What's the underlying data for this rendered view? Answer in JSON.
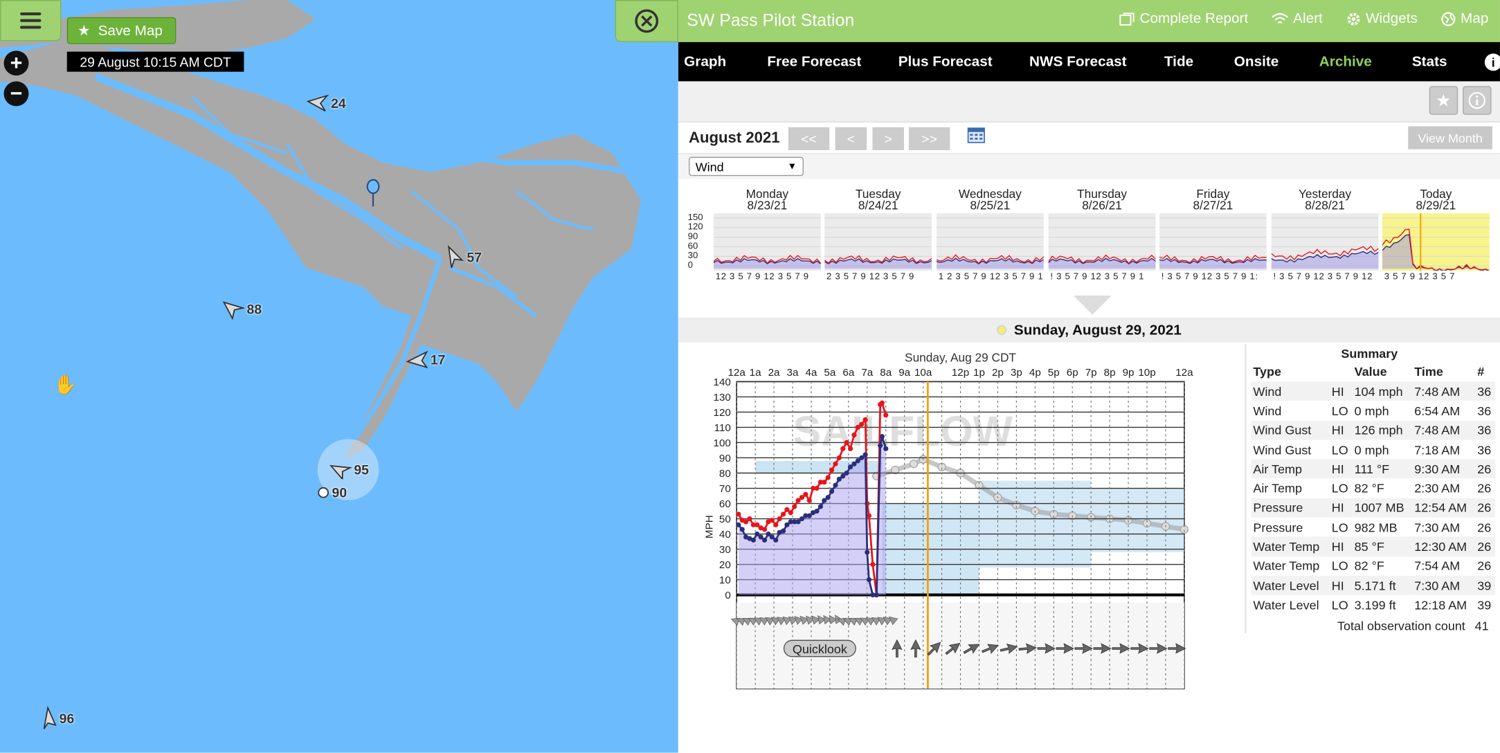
{
  "map": {
    "save_label": "Save Map",
    "timestamp": "29 August 10:15 AM CDT",
    "zoom_in": "+",
    "zoom_out": "−",
    "markers": [
      {
        "value": "24",
        "dir": 260
      },
      {
        "value": "57",
        "dir": 330
      },
      {
        "value": "88",
        "dir": 290
      },
      {
        "value": "17",
        "dir": 250
      },
      {
        "value": "95",
        "dir": 280
      },
      {
        "value": "90",
        "dir": 0
      },
      {
        "value": "96",
        "dir": 350
      }
    ]
  },
  "panel": {
    "station_title": "SW Pass Pilot Station",
    "top_actions": [
      {
        "label": "Complete Report",
        "icon": "report-icon"
      },
      {
        "label": "Alert",
        "icon": "wifi-icon"
      },
      {
        "label": "Widgets",
        "icon": "gear-icon"
      },
      {
        "label": "Map",
        "icon": "globe-icon"
      }
    ],
    "nav": [
      {
        "label": "Graph"
      },
      {
        "label": "Free Forecast"
      },
      {
        "label": "Plus Forecast"
      },
      {
        "label": "NWS Forecast"
      },
      {
        "label": "Tide"
      },
      {
        "label": "Onsite"
      },
      {
        "label": "Archive",
        "active": true
      },
      {
        "label": "Stats"
      }
    ],
    "month_label": "August 2021",
    "pager": [
      "<<",
      "<",
      ">",
      ">>"
    ],
    "view_month": "View Month",
    "select_value": "Wind",
    "week": [
      {
        "name": "Monday",
        "date": "8/23/21",
        "xlabels": "12 3 5 7 9 12 3 5 7 9"
      },
      {
        "name": "Tuesday",
        "date": "8/24/21",
        "xlabels": "2 3 5 7 9 12 3 5 7 9"
      },
      {
        "name": "Wednesday",
        "date": "8/25/21",
        "xlabels": "1 2 3 5 7 9 12 3 5 7 9 1"
      },
      {
        "name": "Thursday",
        "date": "8/26/21",
        "xlabels": "! 3 5 7 9 12 3 5 7 9 1"
      },
      {
        "name": "Friday",
        "date": "8/27/21",
        "xlabels": "! 3 5 7 9 12 3 5 7 9 1:"
      },
      {
        "name": "Yesterday",
        "date": "8/28/21",
        "xlabels": "! 3 5 7 9 12 3 5 7 9 12"
      },
      {
        "name": "Today",
        "date": "8/29/21",
        "xlabels": "3 5 7 9 12 3 5 7"
      }
    ],
    "mini_yticks": [
      "150",
      "120",
      "90",
      "60",
      "30",
      "0"
    ],
    "day_title": "Sunday, August 29, 2021",
    "summary": {
      "title": "Summary",
      "headers": [
        "Type",
        "",
        "Value",
        "Time",
        "#"
      ],
      "rows": [
        [
          "Wind",
          "HI",
          "104 mph",
          "7:48 AM",
          "36"
        ],
        [
          "Wind",
          "LO",
          "0 mph",
          "6:54 AM",
          "36"
        ],
        [
          "Wind Gust",
          "HI",
          "126 mph",
          "7:48 AM",
          "36"
        ],
        [
          "Wind Gust",
          "LO",
          "0 mph",
          "7:18 AM",
          "36"
        ],
        [
          "Air Temp",
          "HI",
          "111 °F",
          "9:30 AM",
          "26"
        ],
        [
          "Air Temp",
          "LO",
          "82 °F",
          "2:30 AM",
          "26"
        ],
        [
          "Pressure",
          "HI",
          "1007 MB",
          "12:54 AM",
          "26"
        ],
        [
          "Pressure",
          "LO",
          "982 MB",
          "7:30 AM",
          "26"
        ],
        [
          "Water Temp",
          "HI",
          "85 °F",
          "12:30 AM",
          "26"
        ],
        [
          "Water Temp",
          "LO",
          "82 °F",
          "7:54 AM",
          "26"
        ],
        [
          "Water Level",
          "HI",
          "5.171 ft",
          "7:30 AM",
          "39"
        ],
        [
          "Water Level",
          "LO",
          "3.199 ft",
          "12:18 AM",
          "39"
        ]
      ],
      "total_label": "Total observation count",
      "total_value": "41"
    },
    "quicklook": "Quicklook"
  },
  "chart_data": {
    "type": "line",
    "title": "Sunday, Aug 29 CDT",
    "ylabel": "MPH",
    "watermark": "SAILFLOW",
    "ylim": [
      0,
      140
    ],
    "yticks": [
      0,
      10,
      20,
      30,
      40,
      50,
      60,
      70,
      80,
      90,
      100,
      110,
      120,
      130,
      140
    ],
    "xticks": [
      "12a",
      "1a",
      "2a",
      "3a",
      "4a",
      "5a",
      "6a",
      "7a",
      "8a",
      "9a",
      "10a",
      "",
      "12p",
      "1p",
      "2p",
      "3p",
      "4p",
      "5p",
      "6p",
      "7p",
      "8p",
      "9p",
      "10p",
      "",
      "12a"
    ],
    "x_range_hours": [
      0,
      24
    ],
    "now_hour": 10.25,
    "series": [
      {
        "name": "Wind Gust",
        "color": "#e8141b",
        "x": [
          0.1,
          0.3,
          0.5,
          0.7,
          0.9,
          1.1,
          1.3,
          1.5,
          1.7,
          1.9,
          2.1,
          2.3,
          2.5,
          2.7,
          2.9,
          3.1,
          3.3,
          3.5,
          3.7,
          3.9,
          4.1,
          4.3,
          4.5,
          4.7,
          4.9,
          5.1,
          5.3,
          5.5,
          5.7,
          5.9,
          6.1,
          6.3,
          6.5,
          6.7,
          6.9,
          7.0,
          7.1,
          7.3,
          7.5,
          7.7,
          7.8,
          8.0
        ],
        "y": [
          53,
          49,
          48,
          50,
          46,
          46,
          44,
          43,
          48,
          49,
          46,
          50,
          53,
          56,
          54,
          58,
          62,
          64,
          66,
          62,
          70,
          70,
          74,
          74,
          77,
          82,
          86,
          90,
          96,
          100,
          96,
          105,
          110,
          112,
          115,
          60,
          52,
          20,
          0,
          125,
          126,
          118
        ]
      },
      {
        "name": "Wind",
        "color": "#2a2f7a",
        "x": [
          0.1,
          0.3,
          0.5,
          0.7,
          0.9,
          1.1,
          1.3,
          1.5,
          1.7,
          1.9,
          2.1,
          2.3,
          2.5,
          2.7,
          2.9,
          3.1,
          3.3,
          3.5,
          3.7,
          3.9,
          4.1,
          4.3,
          4.5,
          4.7,
          4.9,
          5.1,
          5.3,
          5.5,
          5.7,
          5.9,
          6.1,
          6.3,
          6.5,
          6.7,
          6.9,
          7.0,
          7.1,
          7.3,
          7.5,
          7.7,
          7.8,
          8.0
        ],
        "y": [
          46,
          43,
          38,
          37,
          36,
          40,
          38,
          36,
          40,
          38,
          36,
          41,
          42,
          46,
          48,
          48,
          48,
          50,
          52,
          52,
          54,
          55,
          58,
          62,
          64,
          68,
          72,
          76,
          78,
          80,
          84,
          86,
          88,
          90,
          92,
          28,
          10,
          0,
          0,
          98,
          104,
          96
        ]
      }
    ]
  }
}
